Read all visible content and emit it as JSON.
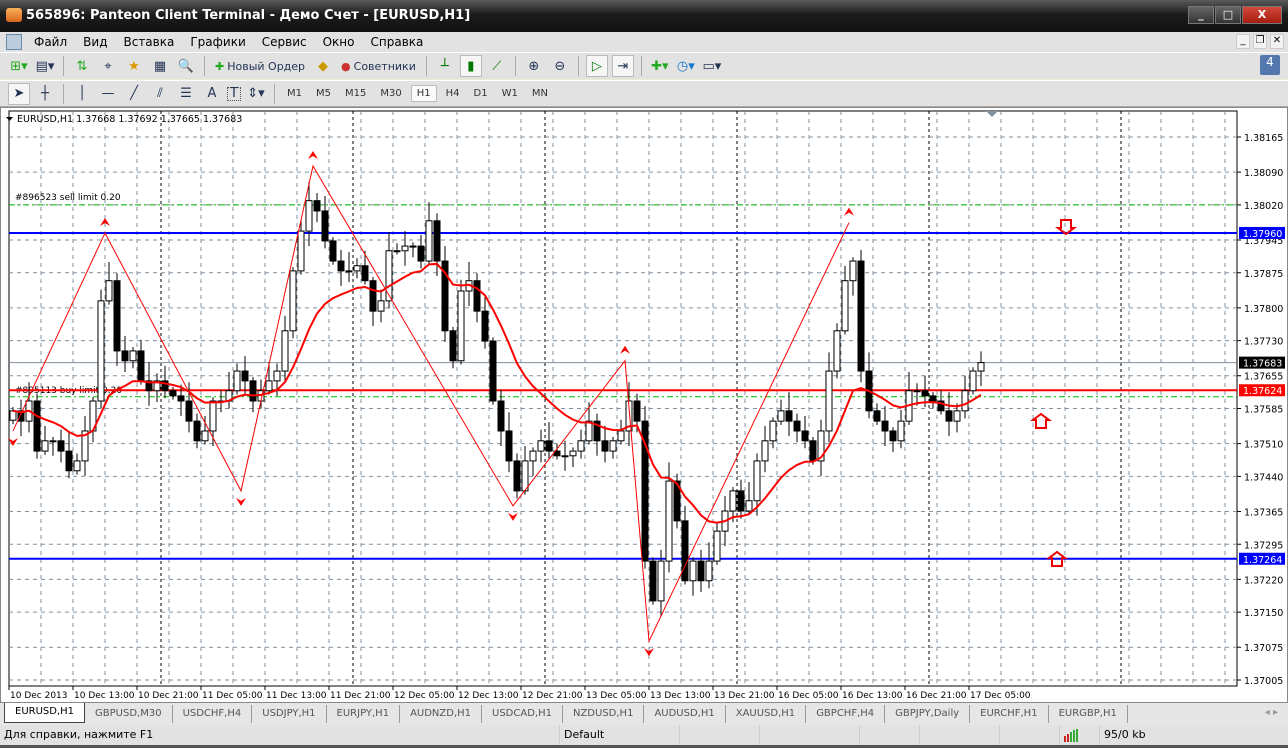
{
  "window": {
    "title": "565896: Panteon Client Terminal - Демо Счет - [EURUSD,H1]",
    "minimize": "_",
    "maximize": "□",
    "close": "X"
  },
  "menu": [
    "Файл",
    "Вид",
    "Вставка",
    "Графики",
    "Сервис",
    "Окно",
    "Справка"
  ],
  "toolbar": {
    "new_order": "Новый Ордер",
    "advisors": "Советники",
    "notifications": "4"
  },
  "drawing_tools": {
    "text_tool": "A",
    "label_tool": "T"
  },
  "timeframes": [
    "M1",
    "M5",
    "M15",
    "M30",
    "H1",
    "H4",
    "D1",
    "W1",
    "MN"
  ],
  "active_timeframe": "H1",
  "chart": {
    "header": "EURUSD,H1  1.37668 1.37692 1.37665 1.37683",
    "sell_limit_label": "#896523 sell limit 0.20",
    "buy_limit_label": "#895113 buy limit 0.20",
    "price_ticks": [
      "1.38165",
      "1.38090",
      "1.38020",
      "1.37945",
      "1.37875",
      "1.37800",
      "1.37730",
      "1.37655",
      "1.37585",
      "1.37510",
      "1.37440",
      "1.37365",
      "1.37295",
      "1.37220",
      "1.37150",
      "1.37075",
      "1.37005"
    ],
    "time_ticks": [
      "10 Dec 2013",
      "10 Dec 13:00",
      "10 Dec 21:00",
      "11 Dec 05:00",
      "11 Dec 13:00",
      "11 Dec 21:00",
      "12 Dec 05:00",
      "12 Dec 13:00",
      "12 Dec 21:00",
      "13 Dec 05:00",
      "13 Dec 13:00",
      "13 Dec 21:00",
      "16 Dec 05:00",
      "16 Dec 13:00",
      "16 Dec 21:00",
      "17 Dec 05:00"
    ],
    "price_min": 1.37005,
    "price_max": 1.38165,
    "levels": [
      {
        "price": "1.37960",
        "color": "#0000ff",
        "kind": "line"
      },
      {
        "price": "1.37264",
        "color": "#0000ff",
        "kind": "line"
      },
      {
        "price": "1.37624",
        "color": "#ff0000",
        "kind": "line"
      },
      {
        "price": "1.37683",
        "color": "#000000",
        "kind": "bid"
      }
    ],
    "sell_limit_price": 1.3802,
    "buy_limit_price": 1.3761,
    "colors": {
      "ma": "#ff0000",
      "zigzag": "#ff0000",
      "order": "#00bb00",
      "bull": "#ffffff",
      "bear": "#000000"
    },
    "closes": [
      1.3758,
      1.37558,
      1.37601,
      1.37494,
      1.37516,
      1.37516,
      1.37494,
      1.37452,
      1.37473,
      1.37537,
      1.37601,
      1.37815,
      1.37858,
      1.37708,
      1.37687,
      1.37708,
      1.37644,
      1.37623,
      1.37644,
      1.37623,
      1.37612,
      1.37601,
      1.37558,
      1.37516,
      1.37537,
      1.37601,
      1.37601,
      1.37623,
      1.37665,
      1.37644,
      1.37601,
      1.37623,
      1.37644,
      1.37665,
      1.37751,
      1.37879,
      1.37964,
      1.38029,
      1.38007,
      1.37943,
      1.379,
      1.37879,
      1.37879,
      1.3789,
      1.37858,
      1.37793,
      1.37815,
      1.37922,
      1.37922,
      1.37932,
      1.37932,
      1.379,
      1.37986,
      1.379,
      1.37751,
      1.37687,
      1.37836,
      1.37858,
      1.37793,
      1.37729,
      1.37601,
      1.37537,
      1.37473,
      1.37409,
      1.37473,
      1.37494,
      1.37516,
      1.37494,
      1.37484,
      1.37484,
      1.37494,
      1.37516,
      1.37558,
      1.37516,
      1.37494,
      1.37516,
      1.37537,
      1.37601,
      1.37558,
      1.37259,
      1.37174,
      1.37259,
      1.3743,
      1.37345,
      1.37217,
      1.37259,
      1.37217,
      1.37259,
      1.37323,
      1.37366,
      1.37409,
      1.37366,
      1.37388,
      1.37473,
      1.37516,
      1.37558,
      1.3758,
      1.37558,
      1.37537,
      1.37516,
      1.37473,
      1.37537,
      1.37665,
      1.37751,
      1.37858,
      1.379,
      1.37665,
      1.3758,
      1.37558,
      1.37537,
      1.37516,
      1.37558,
      1.37623,
      1.37623,
      1.37612,
      1.37601,
      1.3758,
      1.37558,
      1.3758,
      1.37623,
      1.37665,
      1.37683
    ],
    "zigzag": [
      [
        0,
        1.37537
      ],
      [
        11.5,
        1.3796
      ],
      [
        28.5,
        1.37409
      ],
      [
        37.5,
        1.38103
      ],
      [
        62.5,
        1.37377
      ],
      [
        76.5,
        1.37687
      ],
      [
        79.5,
        1.37088
      ],
      [
        104.5,
        1.37982
      ]
    ]
  },
  "tabs": [
    "EURUSD,H1",
    "GBPUSD,M30",
    "USDCHF,H4",
    "USDJPY,H1",
    "EURJPY,H1",
    "AUDNZD,H1",
    "USDCAD,H1",
    "NZDUSD,H1",
    "AUDUSD,H1",
    "XAUUSD,H1",
    "GBPCHF,H4",
    "GBPJPY,Daily",
    "EURCHF,H1",
    "EURGBP,H1"
  ],
  "status": {
    "help": "Для справки, нажмите F1",
    "profile": "Default",
    "traffic": "95/0 kb"
  }
}
